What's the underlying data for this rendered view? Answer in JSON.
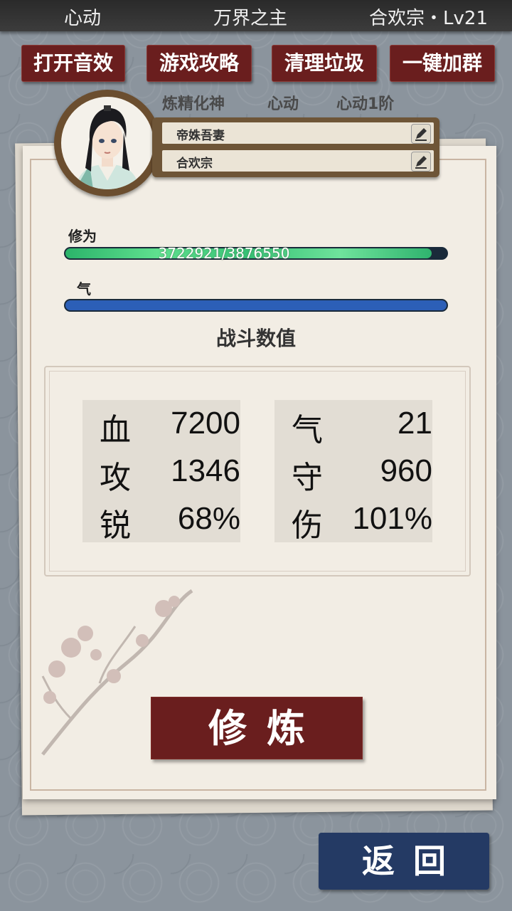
{
  "topbar": {
    "left": "心动",
    "center": "万界之主",
    "right": "合欢宗・Lv21"
  },
  "buttons": {
    "sound": "打开音效",
    "guide": "游戏攻略",
    "clean": "清理垃圾",
    "group": "一键加群"
  },
  "realm": {
    "stage": "炼精化神",
    "name": "心动",
    "level": "心动1阶"
  },
  "profile": {
    "title": "帝姝吾妻",
    "sect": "合欢宗",
    "avatar_icon": "character-portrait"
  },
  "cultivation": {
    "label": "修为",
    "text": "3722921/3876550",
    "progress": 0.9604
  },
  "qi": {
    "label": "气",
    "progress": 1.0
  },
  "stats": {
    "title": "战斗数值",
    "left": [
      {
        "key": "血",
        "value": "7200"
      },
      {
        "key": "攻",
        "value": "1346"
      },
      {
        "key": "锐",
        "value": "68%"
      }
    ],
    "right": [
      {
        "key": "气",
        "value": "21"
      },
      {
        "key": "守",
        "value": "960"
      },
      {
        "key": "伤",
        "value": "101%"
      }
    ]
  },
  "actions": {
    "cultivate": "修炼",
    "back": "返回"
  },
  "colors": {
    "button_red": "#6a1e1e",
    "back_blue": "#243a64",
    "bar_green": "#3ec97c",
    "bar_blue": "#2c5fb7"
  }
}
